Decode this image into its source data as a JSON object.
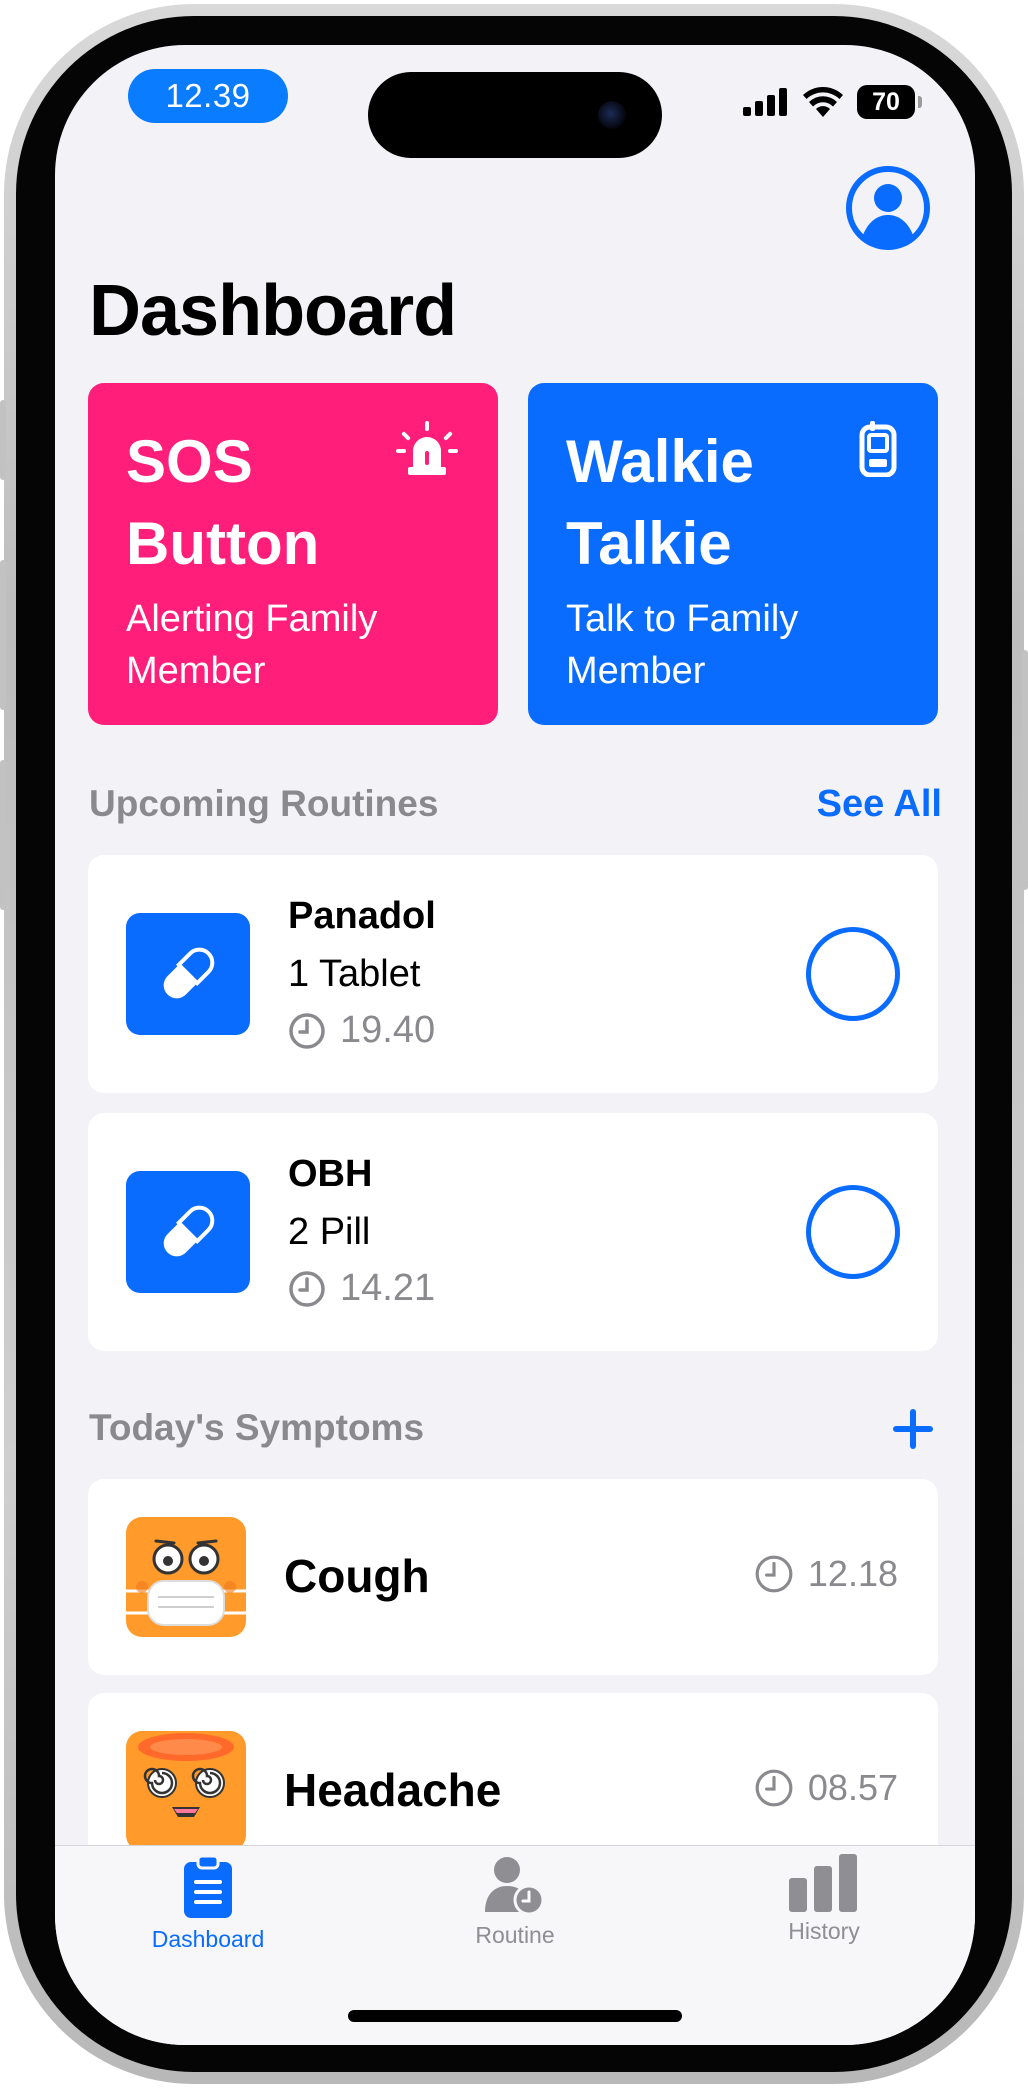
{
  "status_bar": {
    "time": "12.39",
    "battery": "70"
  },
  "header": {
    "title": "Dashboard",
    "profile_icon": "person-circle-icon"
  },
  "actions": [
    {
      "title": "SOS Button",
      "subtitle": "Alerting Family Member",
      "icon": "siren-icon",
      "color": "#ff1f7a"
    },
    {
      "title": "Walkie Talkie",
      "subtitle": "Talk to Family Member",
      "icon": "walkie-talkie-icon",
      "color": "#0a6cff"
    }
  ],
  "routines_section": {
    "title": "Upcoming Routines",
    "see_all": "See All"
  },
  "routines": [
    {
      "name": "Panadol",
      "dose": "1 Tablet",
      "time": "19.40",
      "done": false
    },
    {
      "name": "OBH",
      "dose": "2 Pill",
      "time": "14.21",
      "done": false
    }
  ],
  "symptoms_section": {
    "title": "Today's Symptoms"
  },
  "symptoms": [
    {
      "name": "Cough",
      "time": "12.18",
      "icon": "masked-face-icon"
    },
    {
      "name": "Headache",
      "time": "08.57",
      "icon": "dizzy-face-icon"
    }
  ],
  "tabs": [
    {
      "label": "Dashboard",
      "icon": "clipboard-icon",
      "active": true
    },
    {
      "label": "Routine",
      "icon": "person-clock-icon",
      "active": false
    },
    {
      "label": "History",
      "icon": "bar-chart-icon",
      "active": false
    }
  ],
  "colors": {
    "accent": "#0a6cff",
    "sos": "#ff1f7a",
    "background": "#f2f2f7",
    "secondary_text": "#8a8a8e"
  }
}
